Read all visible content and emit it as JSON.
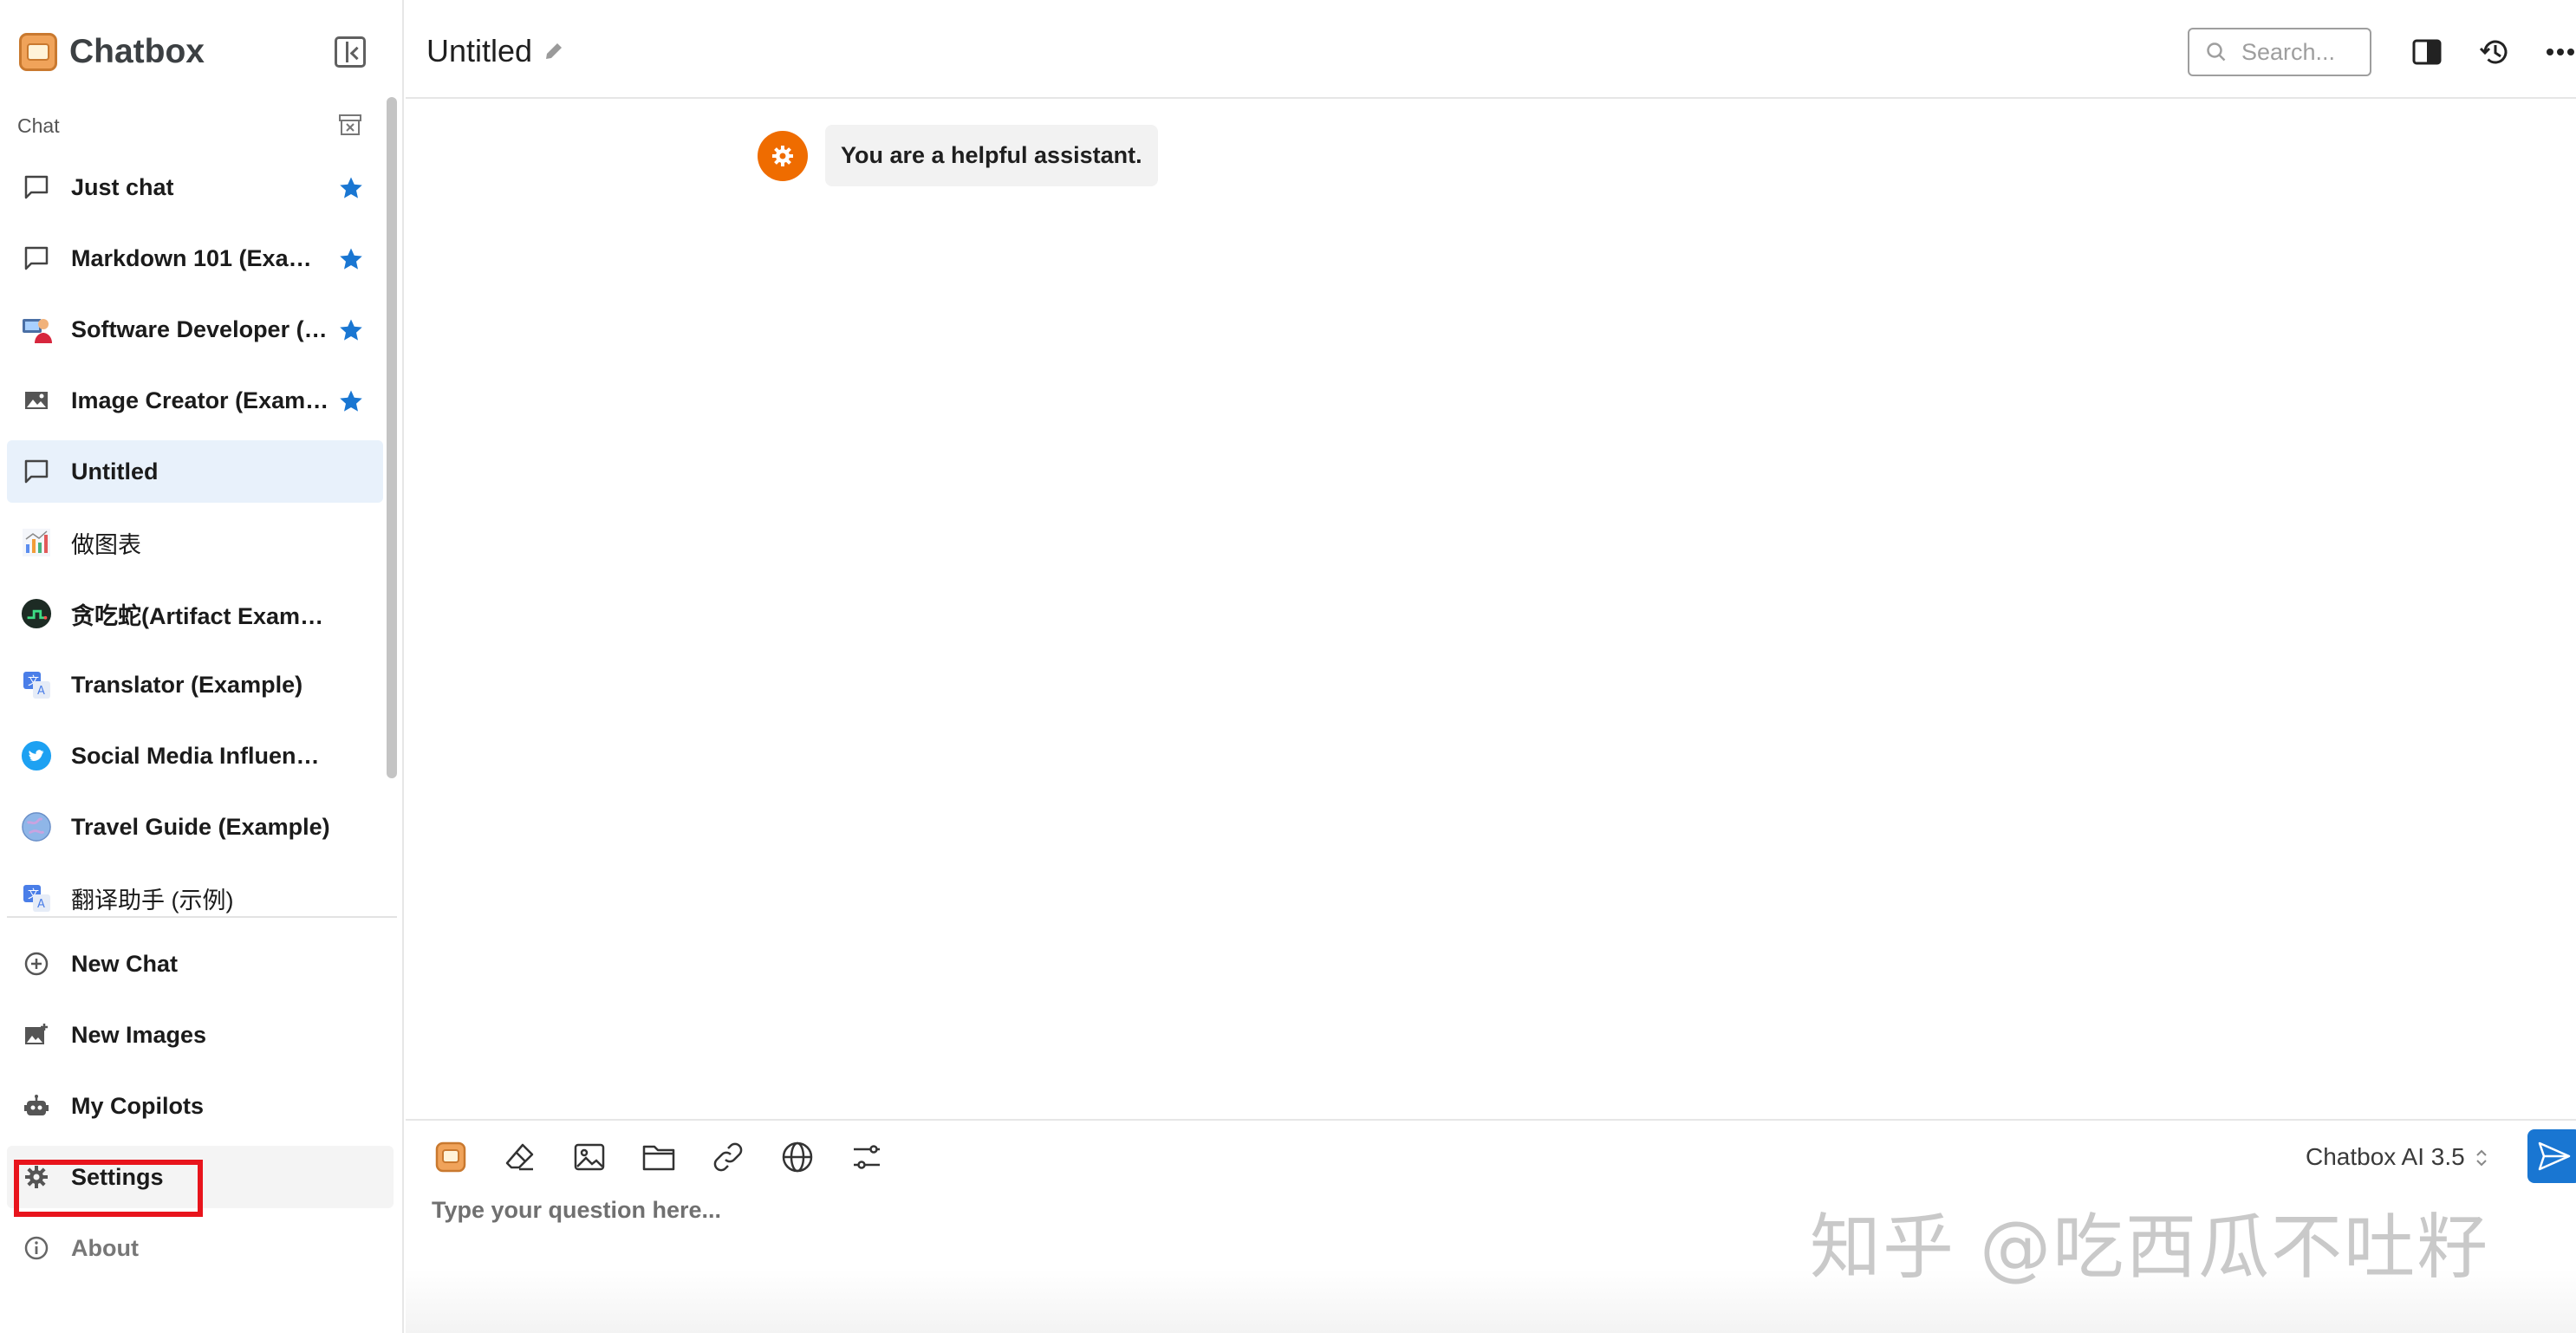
{
  "app": {
    "name": "Chatbox"
  },
  "sidebar": {
    "section_label": "Chat",
    "items": [
      {
        "label": "Just chat",
        "icon": "chat-bubble-icon",
        "starred": true
      },
      {
        "label": "Markdown 101 (Exa…",
        "icon": "chat-bubble-icon",
        "starred": true
      },
      {
        "label": "Software Developer (…",
        "icon": "developer-avatar-icon",
        "starred": true
      },
      {
        "label": "Image Creator (Exam…",
        "icon": "image-icon",
        "starred": true
      },
      {
        "label": "Untitled",
        "icon": "chat-bubble-icon",
        "selected": true
      },
      {
        "label": "做图表",
        "icon": "chart-avatar-icon"
      },
      {
        "label": "贪吃蛇(Artifact Example)",
        "icon": "snake-avatar-icon"
      },
      {
        "label": "Translator (Example)",
        "icon": "translate-avatar-icon"
      },
      {
        "label": "Social Media Influencer (E…",
        "icon": "twitter-avatar-icon"
      },
      {
        "label": "Travel Guide (Example)",
        "icon": "globe-avatar-icon"
      },
      {
        "label": "翻译助手 (示例)",
        "icon": "translate-avatar-icon"
      }
    ],
    "nav": {
      "new_chat": "New Chat",
      "new_images": "New Images",
      "my_copilots": "My Copilots",
      "settings": "Settings",
      "about": "About"
    }
  },
  "header": {
    "title": "Untitled",
    "search_placeholder": "Search..."
  },
  "messages": [
    {
      "role": "system",
      "text": "You are a helpful assistant."
    }
  ],
  "composer": {
    "placeholder": "Type your question here...",
    "model": "Chatbox AI 3.5"
  },
  "watermark": "知乎 @吃西瓜不吐籽",
  "colors": {
    "accent": "#1976d2",
    "selected_bg": "#e8f1fb",
    "star": "#1976d2",
    "system_avatar": "#ef6c00",
    "highlight_box": "#e8141c"
  }
}
